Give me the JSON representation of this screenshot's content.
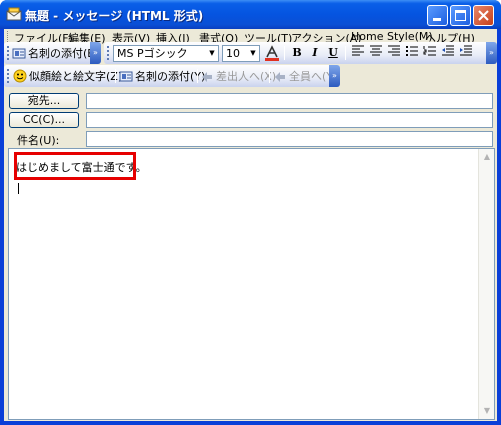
{
  "window": {
    "title": "無題 - メッセージ (HTML 形式)",
    "accent": "#0a5fe8"
  },
  "menu": {
    "items": [
      "ファイル(F)",
      "編集(E)",
      "表示(V)",
      "挿入(I)",
      "書式(O)",
      "ツール(T)",
      "アクション(A)",
      "Home Style(M)",
      "ヘルプ(H)"
    ]
  },
  "toolbar1": {
    "business_card": "名刺の添付(B)",
    "font": "MS Pゴシック",
    "size": "10",
    "bold": "B",
    "italic": "I",
    "underline": "U"
  },
  "toolbar2": {
    "face_mark": "似顔絵と絵文字(Z)",
    "business_card": "名刺の添付(Y)",
    "insert_sender": "差出人へ(X)",
    "all_members": "全員へ(Y)"
  },
  "fields": {
    "to_button": "宛先...",
    "cc_button": "CC(C)...",
    "subject_label": "件名(U):",
    "to_value": "",
    "cc_value": "",
    "subject_value": ""
  },
  "body": {
    "text": "はじめまして富士通です。",
    "highlight_color": "#e60000"
  }
}
